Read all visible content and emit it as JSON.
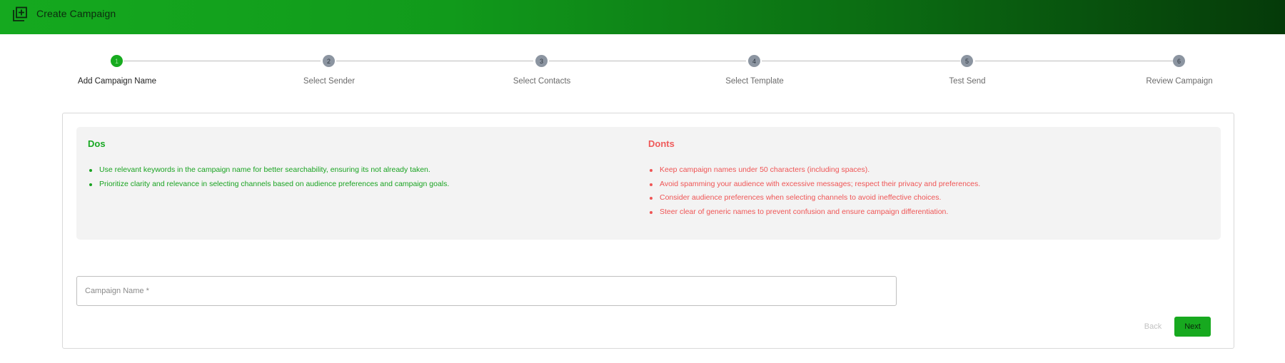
{
  "header": {
    "icon": "add-to-library-icon",
    "title": "Create Campaign",
    "gradient_start": "#15a91f",
    "gradient_end": "#053a09"
  },
  "stepper": {
    "active_step": 1,
    "steps": [
      {
        "number": "1",
        "label": "Add Campaign Name"
      },
      {
        "number": "2",
        "label": "Select Sender"
      },
      {
        "number": "3",
        "label": "Select Contacts"
      },
      {
        "number": "4",
        "label": "Select Template"
      },
      {
        "number": "5",
        "label": "Test Send"
      },
      {
        "number": "6",
        "label": "Review Campaign"
      }
    ]
  },
  "guidelines": {
    "dos": {
      "title": "Dos",
      "color": "#18a822",
      "items": [
        "Use relevant keywords in the campaign name for better searchability, ensuring its not already taken.",
        "Prioritize clarity and relevance in selecting channels based on audience preferences and campaign goals."
      ]
    },
    "donts": {
      "title": "Donts",
      "color": "#ef5a5a",
      "items": [
        "Keep campaign names under 50 characters (including spaces).",
        "Avoid spamming your audience with excessive messages; respect their privacy and preferences.",
        "Consider audience preferences when selecting channels to avoid ineffective choices.",
        "Steer clear of generic names to prevent confusion and ensure campaign differentiation."
      ]
    }
  },
  "form": {
    "campaign_name": {
      "placeholder": "Campaign Name *",
      "value": ""
    }
  },
  "actions": {
    "back_label": "Back",
    "next_label": "Next",
    "primary_color": "#17a91f"
  }
}
